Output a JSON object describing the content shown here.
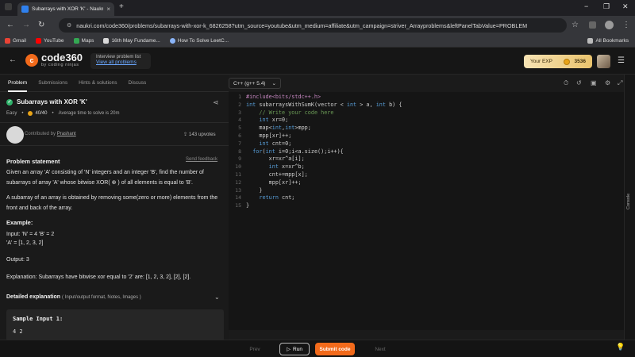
{
  "browser": {
    "tab_title": "Subarrays with XOR 'K' - Naukr",
    "url": "naukri.com/code360/problems/subarrays-with-xor-k_6826258?utm_source=youtube&utm_medium=affiliate&utm_campaign=striver_Arrayproblems&leftPanelTabValue=PROBLEM",
    "bookmarks": [
      "Gmail",
      "YouTube",
      "Maps",
      "16th May Fundame...",
      "How To Solve LeetC..."
    ],
    "all_bookmarks": "All Bookmarks"
  },
  "header": {
    "logo_text": "code360",
    "logo_sub": "by coding ninjas",
    "interview_label": "Interview problem list",
    "interview_link": "View all problems",
    "exp_label": "Your EXP",
    "exp_value": "3536"
  },
  "left": {
    "tabs": [
      "Problem",
      "Submissions",
      "Hints & solutions",
      "Discuss"
    ],
    "title": "Subarrays with XOR 'K'",
    "difficulty": "Easy",
    "points": "40/40",
    "avg_time": "Average time to solve is 20m",
    "contributed_by": "Contributed by",
    "contributor": "Prashant",
    "upvotes": "143 upvotes",
    "statement_h": "Problem statement",
    "send_feedback": "Send feedback",
    "p1": "Given an array 'A' consisting of 'N' integers and an integer 'B', find the number of subarrays of array 'A' whose bitwise XOR( ⊕ ) of all elements is equal to 'B'.",
    "p2": "A subarray of an array is obtained by removing some(zero or more) elements from the front and back of the array.",
    "example_h": "Example:",
    "input_line1": "Input: 'N' = 4 'B' = 2",
    "input_line2": "'A' = [1, 2, 3, 2]",
    "output_line": "Output: 3",
    "explanation_line": "Explanation: Subarrays have bitwise xor equal to '2' are: [1, 2, 3, 2], [2], [2].",
    "detailed_h": "Detailed explanation",
    "detailed_sub": "( Input/output format, Notes, Images )",
    "sample_h": "Sample Input 1:",
    "sample_v": "4 2"
  },
  "editor": {
    "language": "C++ (g++ 5.4)",
    "line_numbers": [
      "1",
      "2",
      "3",
      "4",
      "5",
      "6",
      "7",
      "8",
      "9",
      "10",
      "11",
      "12",
      "13",
      "14",
      "15"
    ],
    "console_label": "Console"
  },
  "bottom": {
    "prev": "Prev",
    "run": "Run",
    "submit": "Submit code",
    "next": "Next"
  },
  "colors": {
    "accent": "#f26a1b",
    "link": "#6aa7ff",
    "success": "#2fb36b"
  }
}
